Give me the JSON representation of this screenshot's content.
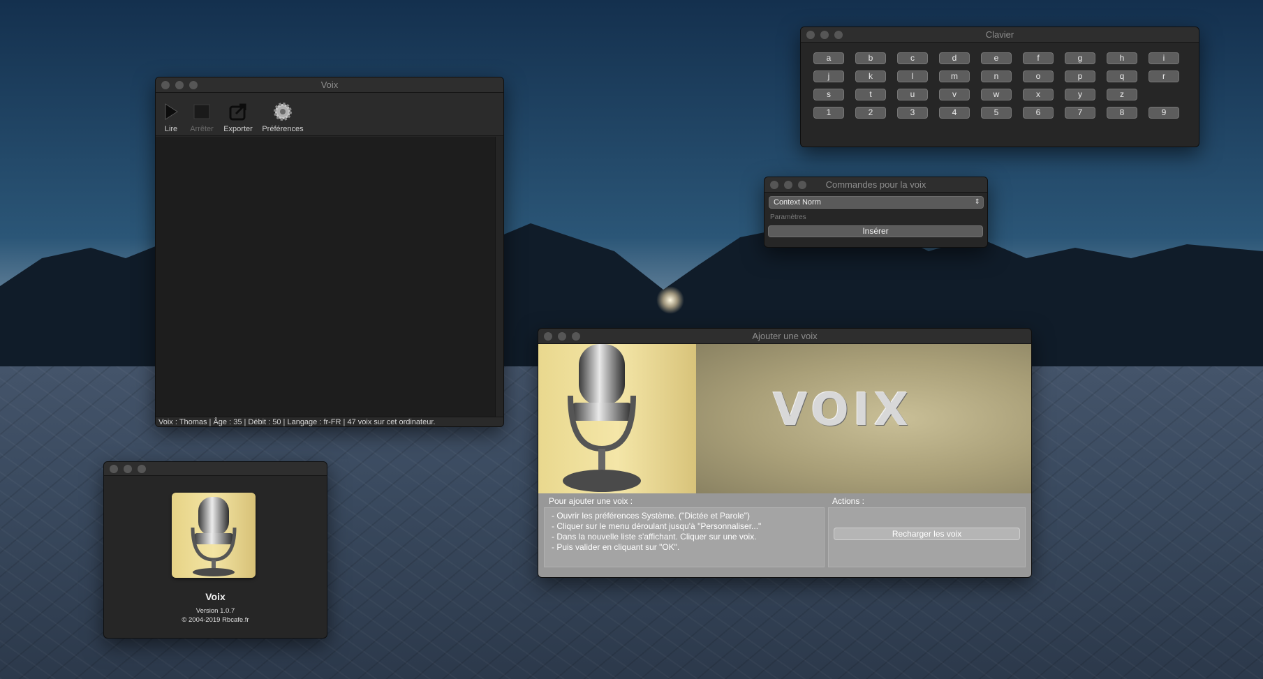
{
  "voix_window": {
    "title": "Voix",
    "toolbar": [
      {
        "label": "Lire",
        "icon": "play-icon",
        "enabled": true
      },
      {
        "label": "Arrêter",
        "icon": "stop-icon",
        "enabled": false
      },
      {
        "label": "Exporter",
        "icon": "export-icon",
        "enabled": true
      },
      {
        "label": "Préférences",
        "icon": "gear-icon",
        "enabled": true
      }
    ],
    "status": "Voix : Thomas  |  Âge : 35  |  Débit : 50  |  Langage : fr-FR  |  47 voix sur cet ordinateur."
  },
  "clavier_window": {
    "title": "Clavier",
    "rows": [
      [
        "a",
        "b",
        "c",
        "d",
        "e",
        "f",
        "g",
        "h",
        "i"
      ],
      [
        "j",
        "k",
        "l",
        "m",
        "n",
        "o",
        "p",
        "q",
        "r"
      ],
      [
        "s",
        "t",
        "u",
        "v",
        "w",
        "x",
        "y",
        "z"
      ],
      [
        "1",
        "2",
        "3",
        "4",
        "5",
        "6",
        "7",
        "8",
        "9"
      ]
    ]
  },
  "commandes_window": {
    "title": "Commandes pour la voix",
    "selected_command": "Context Norm",
    "params_placeholder": "Paramètres",
    "insert_label": "Insérer"
  },
  "ajouter_window": {
    "title": "Ajouter une voix",
    "banner_text": "VOIX",
    "instructions_heading": "Pour ajouter une voix :",
    "instructions": [
      "- Ouvrir les préférences Système. (\"Dictée et Parole\")",
      "- Cliquer sur le menu déroulant jusqu'à \"Personnaliser...\"",
      "- Dans la nouvelle liste s'affichant. Cliquer sur une voix.",
      "- Puis valider en cliquant sur \"OK\"."
    ],
    "actions_heading": "Actions :",
    "reload_label": "Recharger les voix"
  },
  "about_window": {
    "app_name": "Voix",
    "version": "Version 1.0.7",
    "copyright": "© 2004-2019 Rbcafe.fr"
  },
  "colors": {
    "window_bg": "#262626",
    "titlebar": "#2e2e2e",
    "key_bg": "#5d5d5d",
    "banner_gold": "#f3e4a4",
    "banner_khaki": "#a99f78"
  }
}
